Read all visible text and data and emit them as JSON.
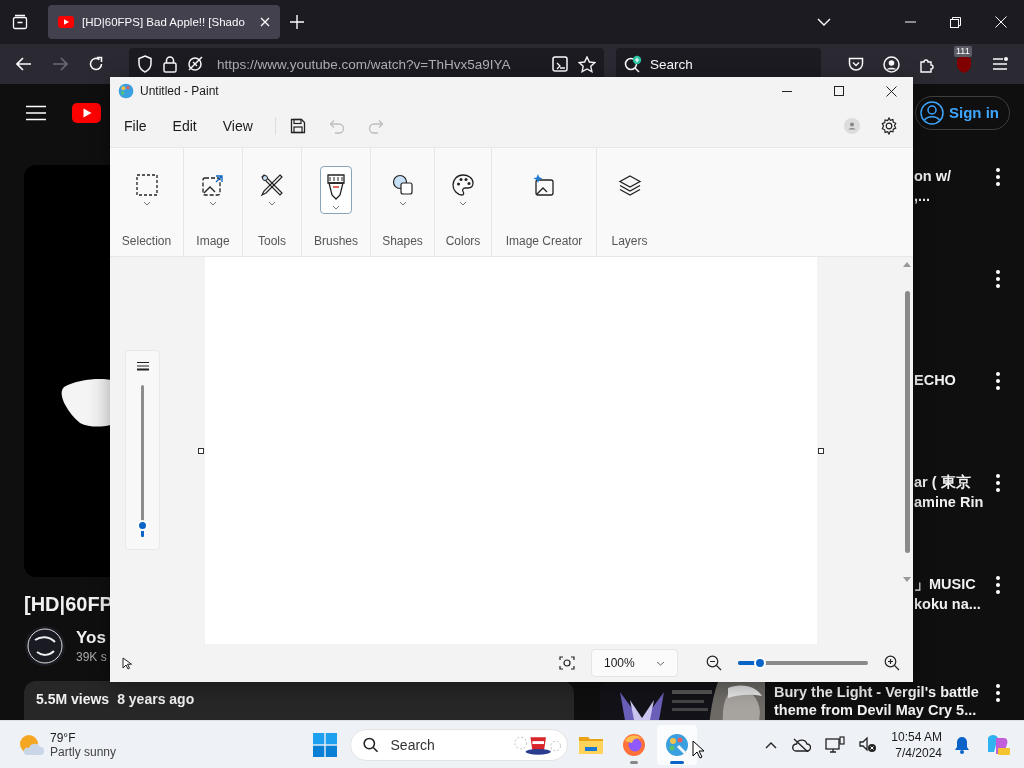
{
  "browser": {
    "tabs": [
      {
        "title": "[HD|60FPS] Bad Apple!! [Shado",
        "selected": true
      }
    ],
    "nav_buttons": [
      {
        "kind": "back",
        "disabled": false
      },
      {
        "kind": "forward",
        "disabled": true
      },
      {
        "kind": "reload",
        "disabled": false
      }
    ],
    "url": "https://www.youtube.com/watch?v=ThHvx5a9IYA",
    "search": {
      "placeholder": "Search"
    },
    "extension_badge": "111"
  },
  "youtube": {
    "title": "[HD|60FP",
    "channel": {
      "name": "Yos",
      "subscribers": "39K s"
    },
    "description": {
      "views": "5.5M views",
      "age": "8 years ago"
    },
    "sign_in": "Sign in",
    "related": [
      {
        "kind": "text",
        "lines": [
          "on w/",
          ",..."
        ]
      },
      {
        "kind": "text"
      },
      {
        "kind": "text",
        "lines": [
          "ECHO"
        ]
      },
      {
        "kind": "text",
        "lines": [
          "ar ( 東京",
          "amine Rin"
        ]
      },
      {
        "kind": "text",
        "lines": [
          "」MUSIC",
          "koku na..."
        ]
      },
      {
        "kind": "picture",
        "lines": [
          "Bury the Light - Vergil's battle",
          "theme from Devil May Cry 5..."
        ]
      }
    ]
  },
  "paint": {
    "title": "Untitled - Paint",
    "menus": [
      "File",
      "Edit",
      "View"
    ],
    "quick": [
      {
        "kind": "save",
        "disabled": false
      },
      {
        "kind": "undo",
        "disabled": true
      },
      {
        "kind": "redo",
        "disabled": true
      }
    ],
    "ribbon": [
      {
        "label": "Selection",
        "selected": false,
        "dropdown": true
      },
      {
        "label": "Image",
        "selected": false,
        "dropdown": true
      },
      {
        "label": "Tools",
        "selected": false,
        "dropdown": true
      },
      {
        "label": "Brushes",
        "selected": true,
        "dropdown": true
      },
      {
        "label": "Shapes",
        "selected": false,
        "dropdown": true
      },
      {
        "label": "Colors",
        "selected": false,
        "dropdown": true
      },
      {
        "label": "Image Creator",
        "selected": false,
        "dropdown": false
      },
      {
        "label": "Layers",
        "selected": false,
        "dropdown": false
      }
    ],
    "brush_size": {
      "level": 0.07
    },
    "zoom": {
      "value": "100%",
      "level": 0.17
    }
  },
  "taskbar": {
    "weather": {
      "temp": "79°F",
      "condition": "Partly sunny"
    },
    "search": {
      "placeholder": "Search"
    },
    "apps": [
      {
        "kind": "explorer",
        "running": false,
        "active": false
      },
      {
        "kind": "firefox",
        "running": true,
        "active": false
      },
      {
        "kind": "paint",
        "running": true,
        "active": true
      }
    ],
    "clock": {
      "time": "10:54 AM",
      "date": "7/4/2024"
    }
  }
}
